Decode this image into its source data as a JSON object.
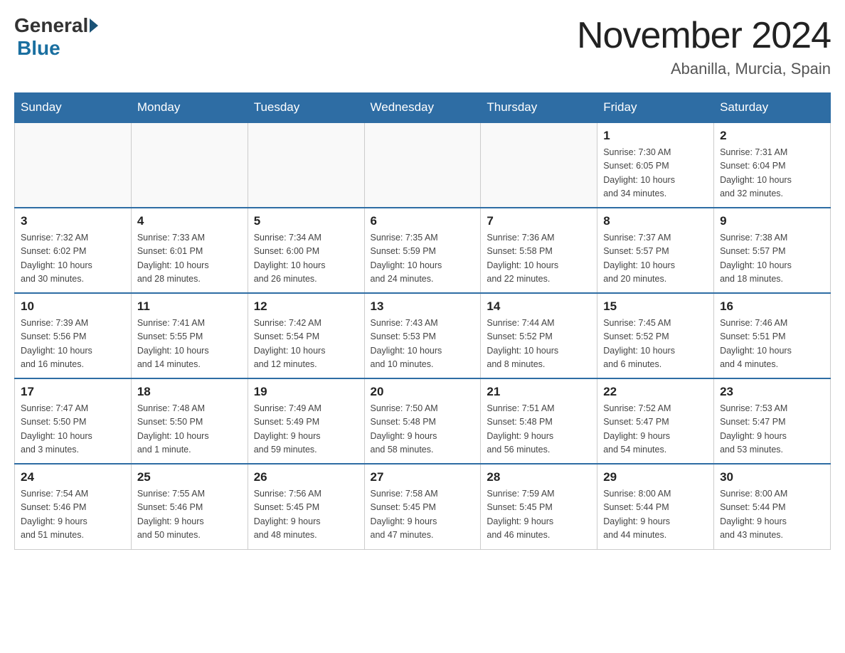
{
  "header": {
    "logo_general": "General",
    "logo_blue": "Blue",
    "month_title": "November 2024",
    "location": "Abanilla, Murcia, Spain"
  },
  "weekdays": [
    "Sunday",
    "Monday",
    "Tuesday",
    "Wednesday",
    "Thursday",
    "Friday",
    "Saturday"
  ],
  "weeks": [
    [
      {
        "day": "",
        "info": ""
      },
      {
        "day": "",
        "info": ""
      },
      {
        "day": "",
        "info": ""
      },
      {
        "day": "",
        "info": ""
      },
      {
        "day": "",
        "info": ""
      },
      {
        "day": "1",
        "info": "Sunrise: 7:30 AM\nSunset: 6:05 PM\nDaylight: 10 hours\nand 34 minutes."
      },
      {
        "day": "2",
        "info": "Sunrise: 7:31 AM\nSunset: 6:04 PM\nDaylight: 10 hours\nand 32 minutes."
      }
    ],
    [
      {
        "day": "3",
        "info": "Sunrise: 7:32 AM\nSunset: 6:02 PM\nDaylight: 10 hours\nand 30 minutes."
      },
      {
        "day": "4",
        "info": "Sunrise: 7:33 AM\nSunset: 6:01 PM\nDaylight: 10 hours\nand 28 minutes."
      },
      {
        "day": "5",
        "info": "Sunrise: 7:34 AM\nSunset: 6:00 PM\nDaylight: 10 hours\nand 26 minutes."
      },
      {
        "day": "6",
        "info": "Sunrise: 7:35 AM\nSunset: 5:59 PM\nDaylight: 10 hours\nand 24 minutes."
      },
      {
        "day": "7",
        "info": "Sunrise: 7:36 AM\nSunset: 5:58 PM\nDaylight: 10 hours\nand 22 minutes."
      },
      {
        "day": "8",
        "info": "Sunrise: 7:37 AM\nSunset: 5:57 PM\nDaylight: 10 hours\nand 20 minutes."
      },
      {
        "day": "9",
        "info": "Sunrise: 7:38 AM\nSunset: 5:57 PM\nDaylight: 10 hours\nand 18 minutes."
      }
    ],
    [
      {
        "day": "10",
        "info": "Sunrise: 7:39 AM\nSunset: 5:56 PM\nDaylight: 10 hours\nand 16 minutes."
      },
      {
        "day": "11",
        "info": "Sunrise: 7:41 AM\nSunset: 5:55 PM\nDaylight: 10 hours\nand 14 minutes."
      },
      {
        "day": "12",
        "info": "Sunrise: 7:42 AM\nSunset: 5:54 PM\nDaylight: 10 hours\nand 12 minutes."
      },
      {
        "day": "13",
        "info": "Sunrise: 7:43 AM\nSunset: 5:53 PM\nDaylight: 10 hours\nand 10 minutes."
      },
      {
        "day": "14",
        "info": "Sunrise: 7:44 AM\nSunset: 5:52 PM\nDaylight: 10 hours\nand 8 minutes."
      },
      {
        "day": "15",
        "info": "Sunrise: 7:45 AM\nSunset: 5:52 PM\nDaylight: 10 hours\nand 6 minutes."
      },
      {
        "day": "16",
        "info": "Sunrise: 7:46 AM\nSunset: 5:51 PM\nDaylight: 10 hours\nand 4 minutes."
      }
    ],
    [
      {
        "day": "17",
        "info": "Sunrise: 7:47 AM\nSunset: 5:50 PM\nDaylight: 10 hours\nand 3 minutes."
      },
      {
        "day": "18",
        "info": "Sunrise: 7:48 AM\nSunset: 5:50 PM\nDaylight: 10 hours\nand 1 minute."
      },
      {
        "day": "19",
        "info": "Sunrise: 7:49 AM\nSunset: 5:49 PM\nDaylight: 9 hours\nand 59 minutes."
      },
      {
        "day": "20",
        "info": "Sunrise: 7:50 AM\nSunset: 5:48 PM\nDaylight: 9 hours\nand 58 minutes."
      },
      {
        "day": "21",
        "info": "Sunrise: 7:51 AM\nSunset: 5:48 PM\nDaylight: 9 hours\nand 56 minutes."
      },
      {
        "day": "22",
        "info": "Sunrise: 7:52 AM\nSunset: 5:47 PM\nDaylight: 9 hours\nand 54 minutes."
      },
      {
        "day": "23",
        "info": "Sunrise: 7:53 AM\nSunset: 5:47 PM\nDaylight: 9 hours\nand 53 minutes."
      }
    ],
    [
      {
        "day": "24",
        "info": "Sunrise: 7:54 AM\nSunset: 5:46 PM\nDaylight: 9 hours\nand 51 minutes."
      },
      {
        "day": "25",
        "info": "Sunrise: 7:55 AM\nSunset: 5:46 PM\nDaylight: 9 hours\nand 50 minutes."
      },
      {
        "day": "26",
        "info": "Sunrise: 7:56 AM\nSunset: 5:45 PM\nDaylight: 9 hours\nand 48 minutes."
      },
      {
        "day": "27",
        "info": "Sunrise: 7:58 AM\nSunset: 5:45 PM\nDaylight: 9 hours\nand 47 minutes."
      },
      {
        "day": "28",
        "info": "Sunrise: 7:59 AM\nSunset: 5:45 PM\nDaylight: 9 hours\nand 46 minutes."
      },
      {
        "day": "29",
        "info": "Sunrise: 8:00 AM\nSunset: 5:44 PM\nDaylight: 9 hours\nand 44 minutes."
      },
      {
        "day": "30",
        "info": "Sunrise: 8:00 AM\nSunset: 5:44 PM\nDaylight: 9 hours\nand 43 minutes."
      }
    ]
  ]
}
